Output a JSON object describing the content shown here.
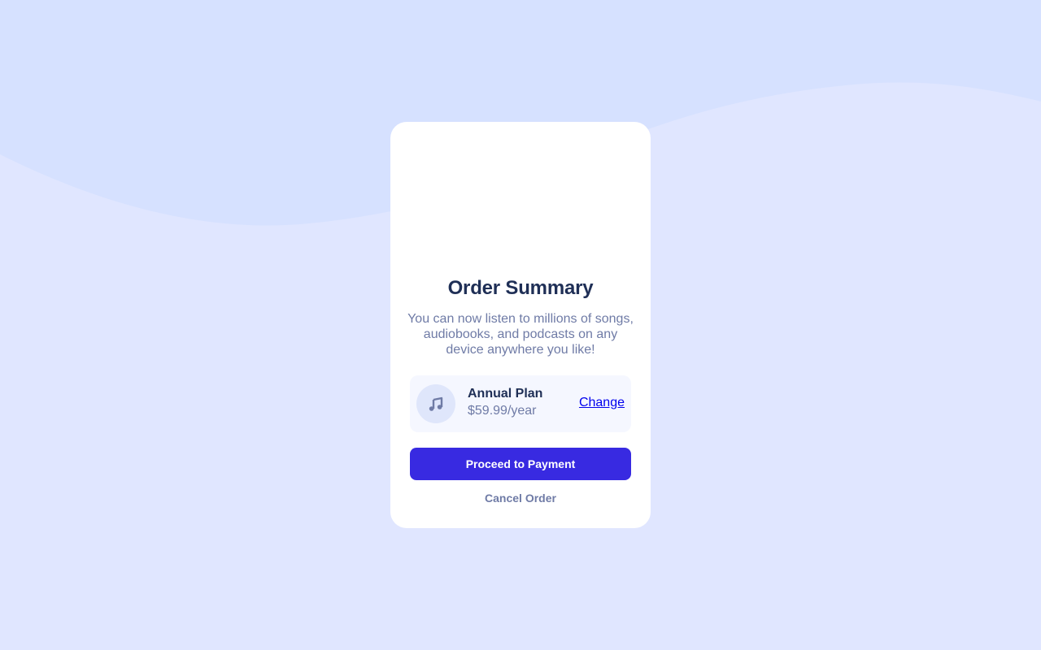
{
  "colors": {
    "page_bg": "#e0e6ff",
    "wave_bg": "#d6e1ff",
    "card_bg": "#ffffff",
    "heading": "#1f2f56",
    "muted": "#6f7ba6",
    "primary": "#382ae1",
    "plan_bg": "#f5f7ff",
    "icon_bg": "#dfe6fb"
  },
  "card": {
    "title": "Order Summary",
    "description": "You can now listen to millions of songs, audiobooks, and podcasts on any device anywhere you like!",
    "plan": {
      "icon": "music-note-icon",
      "name": "Annual Plan",
      "price": "$59.99/year",
      "change_label": "Change"
    },
    "primary_button": "Proceed to Payment",
    "secondary_button": "Cancel Order"
  }
}
